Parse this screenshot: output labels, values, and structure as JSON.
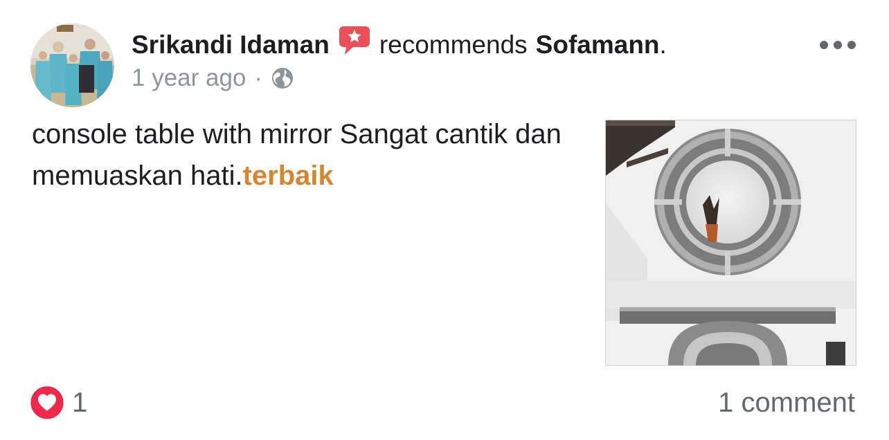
{
  "post": {
    "author": "Srikandi Idaman",
    "action": "recommends",
    "page": "Sofamann",
    "period": ".",
    "time": "1 year ago",
    "separator": "·",
    "text": "console table with mirror Sangat cantik dan memuaskan hati.",
    "hashtag": "terbaik",
    "reactions_count": "1",
    "comments_label": "1 comment"
  },
  "icons": {
    "recommend": "recommend-star-bubble-icon",
    "privacy": "globe-icon",
    "more": "more-options-icon",
    "reaction": "heart-reaction-icon"
  },
  "colors": {
    "hashtag": "#d4872f",
    "recommend_badge": "#e8515a",
    "heart": "#f0284a",
    "meta": "#8d949e"
  }
}
